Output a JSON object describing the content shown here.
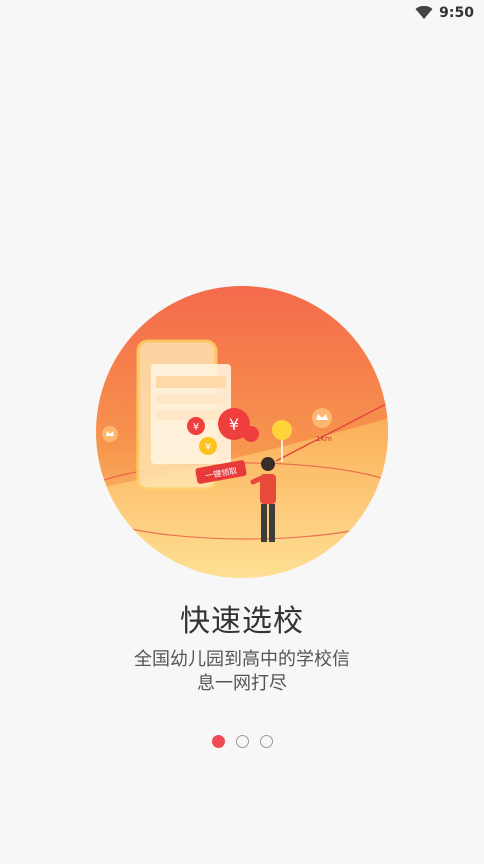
{
  "status_bar": {
    "time": "9:50",
    "icons": [
      "wifi-icon"
    ]
  },
  "hero": {
    "icons": [
      "phone-icon",
      "yuan-coin-icon",
      "location-pin-icon",
      "person-icon",
      "crown-icon"
    ],
    "button_text": "一键领取",
    "label": "1Km"
  },
  "onboarding": {
    "title": "快速选校",
    "desc_line1": "全国幼儿园到高中的学校信",
    "desc_line2": "息一网打尽"
  },
  "pager": {
    "active_index": 0,
    "count": 3,
    "active_color": "#f04a55"
  }
}
